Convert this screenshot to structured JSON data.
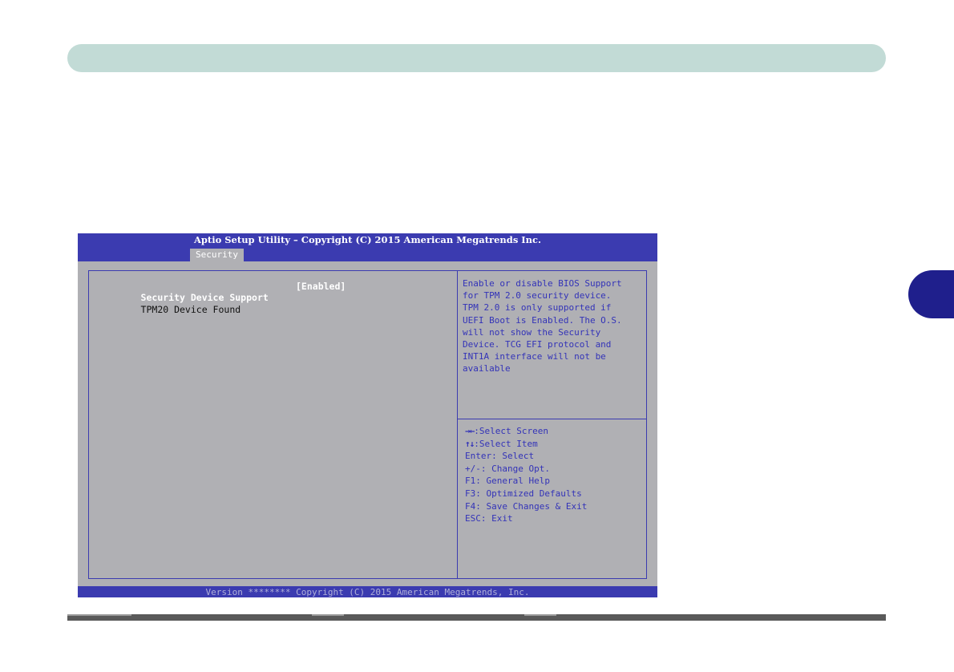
{
  "bios": {
    "title": "Aptio Setup Utility – Copyright (C) 2015 American Megatrends Inc.",
    "active_tab": "Security",
    "items": [
      {
        "label": "Security Device Support",
        "value": "[Enabled]"
      },
      {
        "label": "TPM20 Device Found",
        "value": ""
      }
    ],
    "help_lines": [
      "Enable or disable BIOS Support",
      "for TPM 2.0 security device.",
      "TPM 2.0 is only supported if",
      "UEFI Boot is Enabled. The O.S.",
      "will not show the Security",
      "Device. TCG EFI protocol and",
      "INT1A interface will not be",
      "available"
    ],
    "keys": [
      {
        "arrows": "→←",
        "text": ":Select Screen"
      },
      {
        "arrows": "↑↓",
        "text": ":Select Item"
      },
      {
        "arrows": "",
        "text": "Enter: Select"
      },
      {
        "arrows": "",
        "text": "+/-: Change Opt."
      },
      {
        "arrows": "",
        "text": "F1: General Help"
      },
      {
        "arrows": "",
        "text": "F3: Optimized Defaults"
      },
      {
        "arrows": "",
        "text": "F4: Save Changes & Exit"
      },
      {
        "arrows": "",
        "text": "ESC: Exit"
      }
    ],
    "footer": "Version ******** Copyright (C) 2015 American Megatrends, Inc."
  },
  "colors": {
    "header": "#3b3bb0",
    "body": "#b0b0b4",
    "help_text": "#3333b8",
    "top_bar": "#c2dbd6",
    "side_tab": "#1f1f8c"
  }
}
